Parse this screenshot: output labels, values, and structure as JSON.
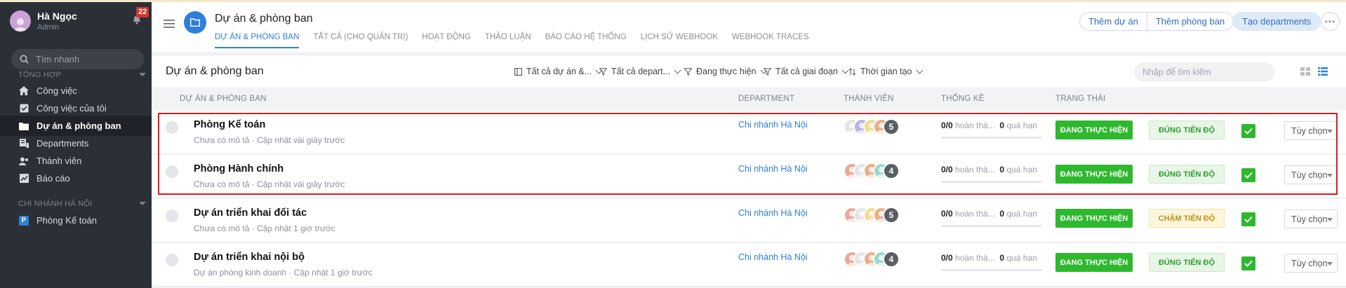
{
  "user": {
    "name": "Hà Ngọc",
    "role": "Admin",
    "notifications": "22"
  },
  "sidebar": {
    "search_placeholder": "Tìm nhanh",
    "section_overview": "TỔNG HỢP",
    "items": [
      {
        "label": "Công việc",
        "icon": "home-icon"
      },
      {
        "label": "Công việc của tôi",
        "icon": "checkbox-icon"
      },
      {
        "label": "Dự án & phòng ban",
        "icon": "folder-icon",
        "active": true
      },
      {
        "label": "Departments",
        "icon": "departments-icon"
      },
      {
        "label": "Thành viên",
        "icon": "members-icon"
      },
      {
        "label": "Báo cáo",
        "icon": "chart-icon"
      }
    ],
    "section_branch": "CHI NHÁNH HÀ NỘI",
    "branch_items": [
      {
        "label": "Phòng Kế toán",
        "badge": "P"
      }
    ]
  },
  "header": {
    "title": "Dự án & phòng ban",
    "tabs": [
      "DỰ ÁN & PHÒNG BAN",
      "TẤT CẢ (CHO QUẢN TRỊ)",
      "HOẠT ĐỘNG",
      "THẢO LUẬN",
      "BÁO CÁO HỆ THỐNG",
      "LỊCH SỬ WEBHOOK",
      "WEBHOOK TRACES"
    ],
    "add_project": "Thêm dự án",
    "add_department": "Thêm phòng ban",
    "create_departments": "Tạo departments",
    "more": "•••"
  },
  "toolbar": {
    "title": "Dự án & phòng ban",
    "filters": [
      "Tất cả dự án &...",
      "Tất cả depart...",
      "Đang thực hiện",
      "Tất cả giai đoạn",
      "Thời gian tạo"
    ],
    "search_placeholder": "Nhập để tìm kiếm"
  },
  "table": {
    "columns": [
      "DỰ ÁN & PHÒNG BAN",
      "DEPARTMENT",
      "THÀNH VIÊN",
      "THỐNG KÊ",
      "TRẠNG THÁI"
    ],
    "rows": [
      {
        "name": "Phòng Kế toán",
        "desc": "Chưa có mô tả · Cập nhật vài giây trước",
        "department": "Chi nhánh Hà Nội",
        "member_count": "5",
        "stats_done": "0/0",
        "stats_done_label": " hoàn thà...",
        "stats_overdue": "0",
        "stats_overdue_label": " quá hạn",
        "status": "ĐANG THỰC HIỆN",
        "progress": "ĐÚNG TIẾN ĐỘ",
        "progress_state": "ok",
        "options": "Tùy chọn"
      },
      {
        "name": "Phòng Hành chính",
        "desc": "Chưa có mô tả · Cập nhật vài giây trước",
        "department": "Chi nhánh Hà Nội",
        "member_count": "4",
        "stats_done": "0/0",
        "stats_done_label": " hoàn thà...",
        "stats_overdue": "0",
        "stats_overdue_label": " quá hạn",
        "status": "ĐANG THỰC HIỆN",
        "progress": "ĐÚNG TIẾN ĐỘ",
        "progress_state": "ok",
        "options": "Tùy chọn"
      },
      {
        "name": "Dự án triển khai đối tác",
        "desc": "Chưa có mô tả · Cập nhật 1 giờ trước",
        "department": "Chi nhánh Hà Nội",
        "member_count": "5",
        "stats_done": "0/0",
        "stats_done_label": " hoàn thà...",
        "stats_overdue": "0",
        "stats_overdue_label": " quá hạn",
        "status": "ĐANG THỰC HIỆN",
        "progress": "CHẬM TIẾN ĐỘ",
        "progress_state": "late",
        "options": "Tùy chọn"
      },
      {
        "name": "Dự án triển khai nội bộ",
        "desc": "Dự án phòng kinh doanh · Cập nhật 1 giờ trước",
        "department": "Chi nhánh Hà Nội",
        "member_count": "4",
        "stats_done": "0/0",
        "stats_done_label": " hoàn thà...",
        "stats_overdue": "0",
        "stats_overdue_label": " quá hạn",
        "status": "ĐANG THỰC HIỆN",
        "progress": "ĐÚNG TIẾN ĐỘ",
        "progress_state": "ok",
        "options": "Tùy chọn"
      }
    ]
  },
  "colors": {
    "accent": "#2e7fd9",
    "status_green": "#2eb82e",
    "sidebar_bg": "#2b2f36",
    "highlight": "#e0191e"
  }
}
